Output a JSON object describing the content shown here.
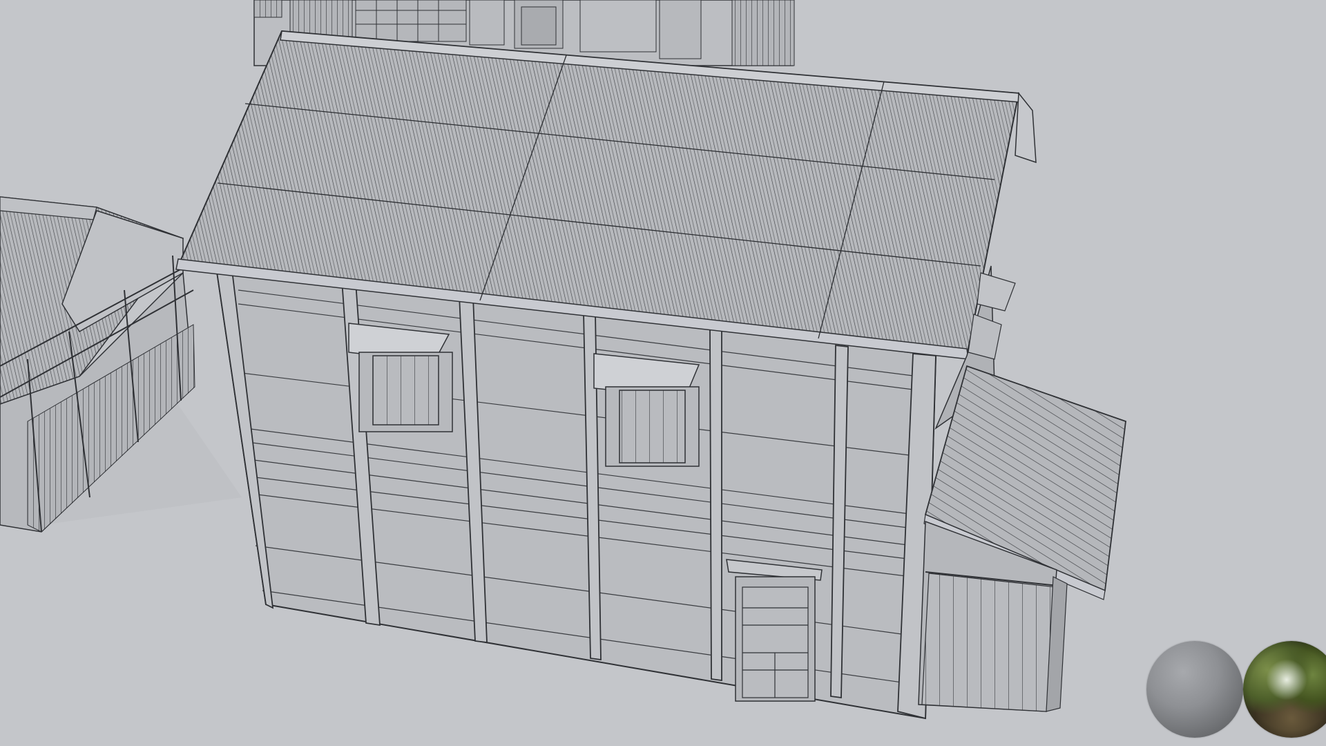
{
  "viewport": {
    "mode": "solid-shaded-wireframe",
    "background_color": "#c4c6ca",
    "model_fill_color": "#b9bbbf",
    "edge_color": "#2e3034"
  },
  "scene": {
    "objects": [
      {
        "name": "main-warehouse",
        "kind": "building",
        "roof": "corrugated"
      },
      {
        "name": "left-shed",
        "kind": "building",
        "roof": "corrugated"
      },
      {
        "name": "back-building",
        "kind": "building"
      },
      {
        "name": "side-lean-to",
        "kind": "building",
        "roof": "plank"
      }
    ]
  },
  "lookdev": {
    "matte_sphere_icon": "matte-sphere-icon",
    "hdri_sphere_icon": "hdri-sphere-icon"
  }
}
